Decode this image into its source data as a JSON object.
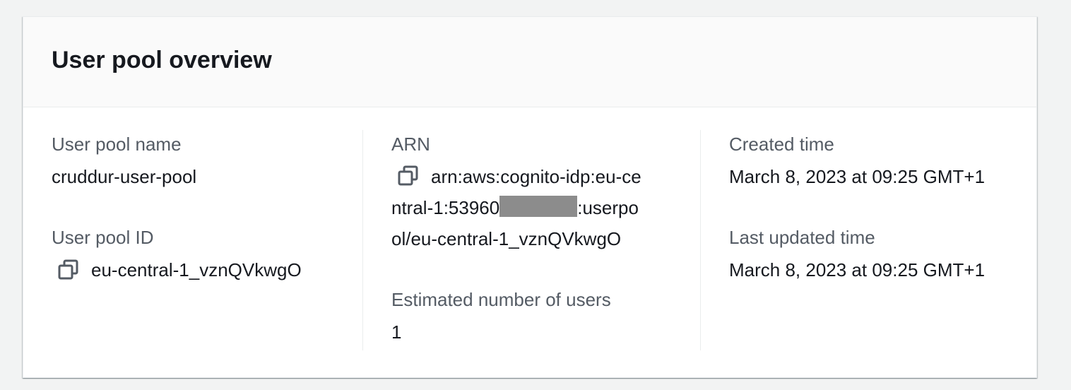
{
  "panel": {
    "title": "User pool overview"
  },
  "fields": {
    "user_pool_name": {
      "label": "User pool name",
      "value": "cruddur-user-pool"
    },
    "user_pool_id": {
      "label": "User pool ID",
      "value": "eu-central-1_vznQVkwgO",
      "copy_icon": "copy-icon"
    },
    "arn": {
      "label": "ARN",
      "line1": "arn:aws:cognito-idp:eu-ce",
      "line2_prefix": "ntral-1:53960",
      "line2_suffix": ":userpo",
      "line3": "ol/eu-central-1_vznQVkwgO",
      "copy_icon": "copy-icon"
    },
    "estimated_users": {
      "label": "Estimated number of users",
      "value": "1"
    },
    "created_time": {
      "label": "Created time",
      "value": "March 8, 2023 at 09:25 GMT+1"
    },
    "last_updated_time": {
      "label": "Last updated time",
      "value": "March 8, 2023 at 09:25 GMT+1"
    }
  },
  "colors": {
    "page_bg": "#f2f3f3",
    "panel_bg": "#ffffff",
    "header_bg": "#fafafa",
    "label": "#545b64",
    "text": "#16191f",
    "redaction": "#8c8c8c"
  }
}
